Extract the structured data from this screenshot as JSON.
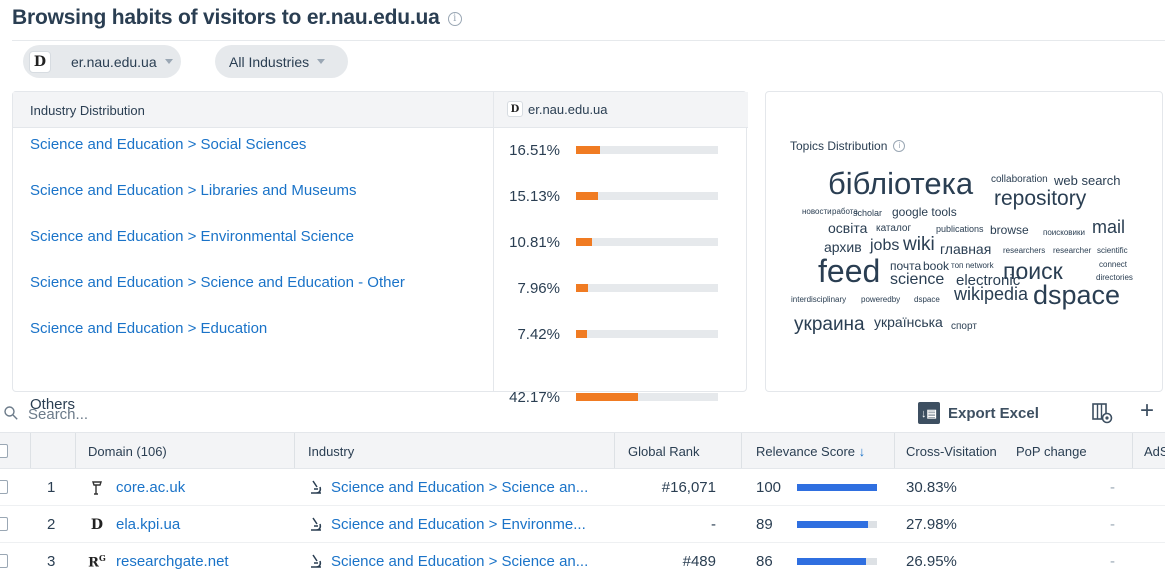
{
  "page": {
    "title": "Browsing habits of visitors to er.nau.edu.ua",
    "info_icon": "info-icon"
  },
  "filters": {
    "site_chip": {
      "label": "er.nau.edu.ua",
      "icon": "site-favicon"
    },
    "industry_chip": {
      "label": "All Industries"
    }
  },
  "industry_distribution": {
    "header": "Industry Distribution",
    "site_header": "er.nau.edu.ua",
    "bar_color": "#f07b22",
    "rows": [
      {
        "name": "Science and Education > Social Sciences",
        "pct": "16.51%",
        "value": 16.51,
        "is_link": true
      },
      {
        "name": "Science and Education > Libraries and Museums",
        "pct": "15.13%",
        "value": 15.13,
        "is_link": true
      },
      {
        "name": "Science and Education > Environmental Science",
        "pct": "10.81%",
        "value": 10.81,
        "is_link": true
      },
      {
        "name": "Science and Education > Science and Education - Other",
        "pct": "7.96%",
        "value": 7.96,
        "is_link": true
      },
      {
        "name": "Science and Education > Education",
        "pct": "7.42%",
        "value": 7.42,
        "is_link": true
      },
      {
        "name": "Others",
        "pct": "42.17%",
        "value": 42.17,
        "is_link": false
      }
    ]
  },
  "topics": {
    "label": "Topics Distribution",
    "words": [
      "бібліотека",
      "collaboration",
      "web search",
      "repository",
      "новости",
      "работа",
      "scholar",
      "google tools",
      "освіта",
      "каталог",
      "publications",
      "browse",
      "поисковики",
      "mail",
      "архив",
      "jobs",
      "wiki",
      "главная",
      "researchers",
      "researcher",
      "scientific",
      "feed",
      "почта",
      "book",
      "топ network",
      "поиск",
      "connect",
      "science",
      "electronic",
      "directories",
      "interdisciplinary",
      "poweredby",
      "dspace",
      "wikipedia",
      "dspace",
      "украина",
      "українська",
      "спорт"
    ]
  },
  "toolbar": {
    "search_placeholder": "Search...",
    "export_label": "Export Excel",
    "export_icon": "excel-icon",
    "settings_icon": "column-settings-icon",
    "add_icon": "plus-icon"
  },
  "table": {
    "columns": [
      "Domain (106)",
      "Industry",
      "Global Rank",
      "Relevance Score",
      "Cross-Visitation",
      "PoP change",
      "AdSense"
    ],
    "sort_icon": "arrow-down-icon",
    "rel_bar_color": "#2f6fe0",
    "rows": [
      {
        "num": "1",
        "domain": "core.ac.uk",
        "icon": "core-logo-icon",
        "industry": "Science and Education > Science an...",
        "global_rank": "#16,071",
        "relevance": "100",
        "relevance_value": 100,
        "cross_visitation": "30.83%",
        "pop_change": "-"
      },
      {
        "num": "2",
        "domain": "ela.kpi.ua",
        "icon": "site-favicon",
        "industry": "Science and Education > Environme...",
        "global_rank": "-",
        "relevance": "89",
        "relevance_value": 89,
        "cross_visitation": "27.98%",
        "pop_change": "-"
      },
      {
        "num": "3",
        "domain": "researchgate.net",
        "icon": "researchgate-icon",
        "industry": "Science and Education > Science an...",
        "global_rank": "#489",
        "relevance": "86",
        "relevance_value": 86,
        "cross_visitation": "26.95%",
        "pop_change": "-"
      }
    ]
  }
}
